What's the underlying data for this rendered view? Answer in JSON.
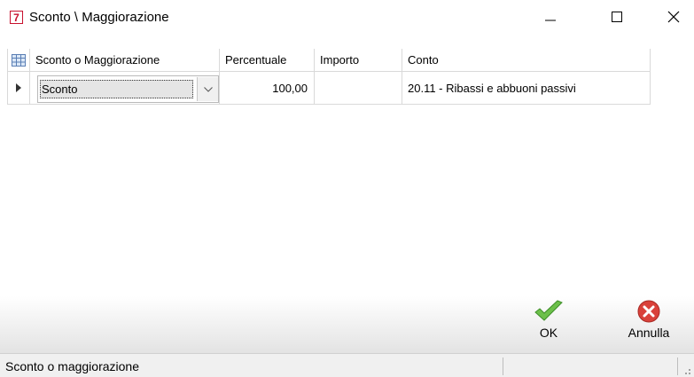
{
  "window": {
    "title": "Sconto \\ Maggiorazione",
    "app_icon_glyph": "7",
    "controls": [
      "minimize",
      "maximize",
      "close"
    ]
  },
  "grid": {
    "columns": [
      "Sconto o Maggiorazione",
      "Percentuale",
      "Importo",
      "Conto"
    ],
    "rows": [
      {
        "tipo": "Sconto",
        "percentuale": "100,00",
        "importo": "",
        "conto": "20.11 - Ribassi e abbuoni passivi"
      }
    ]
  },
  "actions": {
    "ok_label": "OK",
    "annulla_label": "Annulla"
  },
  "status": {
    "text": "Sconto o maggiorazione"
  },
  "colors": {
    "brand_red": "#c8102e",
    "ok_green": "#6cc04a",
    "cancel_red": "#d9413a",
    "grid_line": "#d9d9d9"
  }
}
